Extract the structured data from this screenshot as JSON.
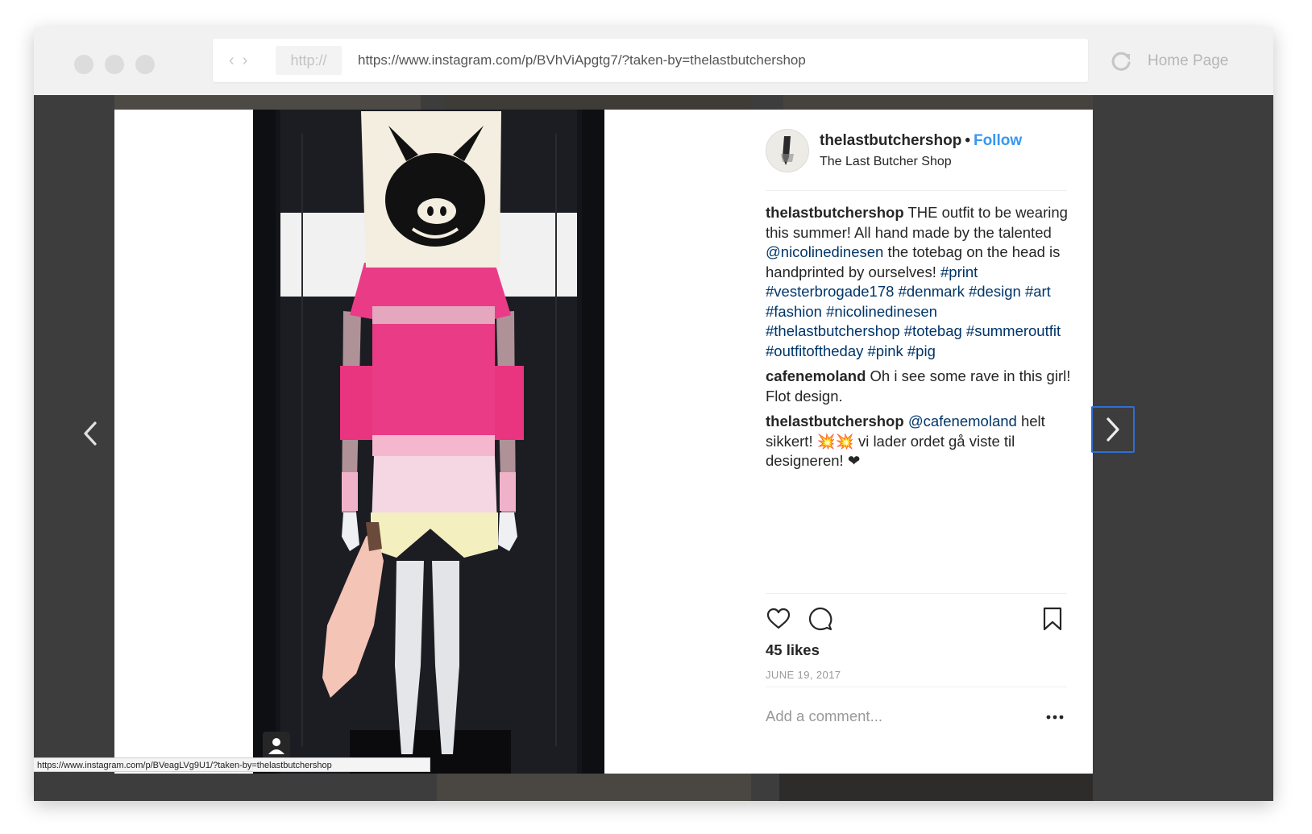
{
  "browser": {
    "url_protocol": "http://",
    "url": "https://www.instagram.com/p/BVhViApgtg7/?taken-by=thelastbutchershop",
    "home_label": "Home Page",
    "back_icon": "chevron-left-icon",
    "forward_icon": "chevron-right-icon",
    "reload_icon": "reload-icon"
  },
  "post": {
    "username": "thelastbutchershop",
    "bullet": "•",
    "follow_label": "Follow",
    "location": "The Last Butcher Shop",
    "comments": [
      {
        "user": "thelastbutchershop",
        "parts": [
          {
            "t": " THE outfit to be wearing this summer! All hand made by the talented "
          },
          {
            "t": "@nicolinedinesen",
            "link": true
          },
          {
            "t": " the totebag on the head is handprinted by ourselves! "
          },
          {
            "t": "#print",
            "link": true
          },
          {
            "t": " "
          },
          {
            "t": "#vesterbrogade178",
            "link": true
          },
          {
            "t": " "
          },
          {
            "t": "#denmark",
            "link": true
          },
          {
            "t": " "
          },
          {
            "t": "#design",
            "link": true
          },
          {
            "t": " "
          },
          {
            "t": "#art",
            "link": true
          },
          {
            "t": " "
          },
          {
            "t": "#fashion",
            "link": true
          },
          {
            "t": " "
          },
          {
            "t": "#nicolinedinesen",
            "link": true
          },
          {
            "t": " "
          },
          {
            "t": "#thelastbutchershop",
            "link": true
          },
          {
            "t": " "
          },
          {
            "t": "#totebag",
            "link": true
          },
          {
            "t": " "
          },
          {
            "t": "#summeroutfit",
            "link": true
          },
          {
            "t": " "
          },
          {
            "t": "#outfitoftheday",
            "link": true
          },
          {
            "t": " "
          },
          {
            "t": "#pink",
            "link": true
          },
          {
            "t": " "
          },
          {
            "t": "#pig",
            "link": true
          }
        ]
      },
      {
        "user": "cafenemoland",
        "parts": [
          {
            "t": " Oh i see some rave in this girl! Flot design."
          }
        ]
      },
      {
        "user": "thelastbutchershop",
        "parts": [
          {
            "t": " "
          },
          {
            "t": "@cafenemoland",
            "link": true
          },
          {
            "t": " helt sikkert! 💥💥 vi lader ordet gå viste til designeren! ❤"
          }
        ]
      }
    ],
    "likes": "45 likes",
    "date": "JUNE 19, 2017",
    "comment_placeholder": "Add a comment...",
    "icons": [
      "heart-icon",
      "comment-icon",
      "bookmark-icon",
      "more-options-icon",
      "user-tag-icon"
    ]
  },
  "status_url": "https://www.instagram.com/p/BVeagLVg9U1/?taken-by=thelastbutchershop",
  "colors": {
    "follow": "#3897f0",
    "link": "#003569",
    "muted": "#999999",
    "backdrop": "#3d3d3d",
    "focus_ring": "#2e6fd6"
  }
}
